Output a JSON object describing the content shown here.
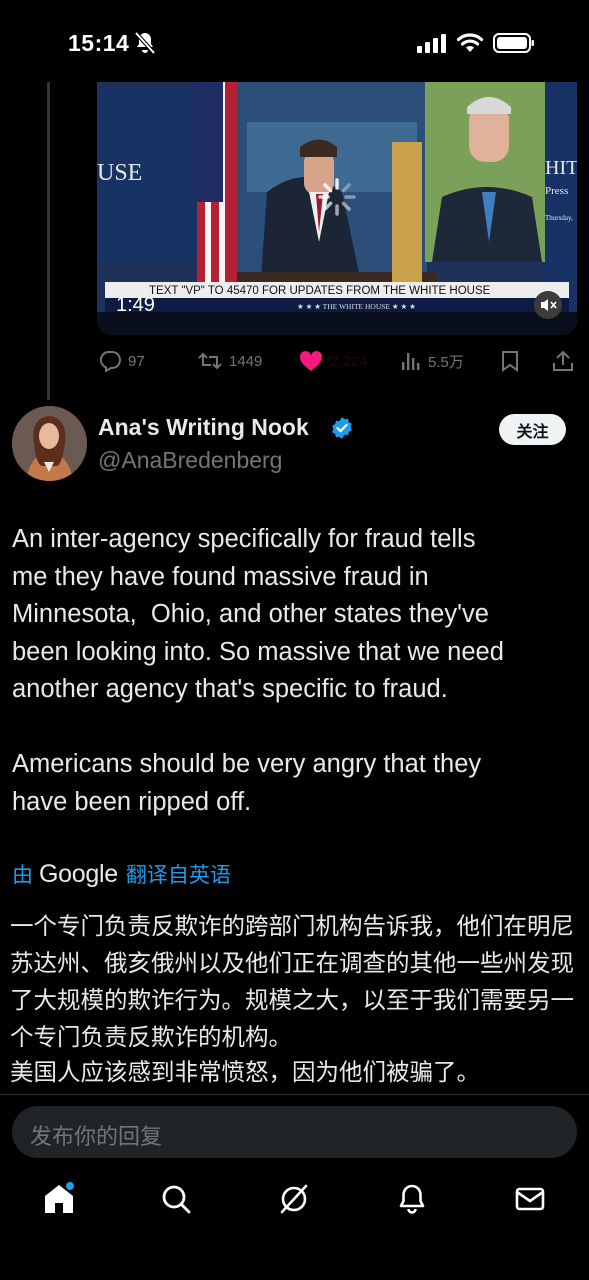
{
  "status_bar": {
    "time": "15:14",
    "icons": [
      "bell-muted-icon",
      "signal-icon",
      "wifi-icon",
      "battery-icon"
    ]
  },
  "video": {
    "duration": "1:49",
    "chyron": "TEXT \"VP\" TO 45470 FOR UPDATES FROM THE WHITE HOUSE",
    "chyron_sub": "★ ★ ★  THE WHITE HOUSE  ★ ★ ★",
    "backdrop_left_text": "USE",
    "backdrop_right_text": "HIT",
    "backdrop_right_sub": "Press",
    "backdrop_right_date": "Thursday,"
  },
  "actions": {
    "replies": "97",
    "reposts": "1449",
    "likes": "2,224",
    "views": "5.5万"
  },
  "author": {
    "name": "Ana's Writing Nook",
    "handle": "@AnaBredenberg",
    "follow_label": "关注",
    "verified": true
  },
  "tweet": {
    "text": "An inter-agency specifically for fraud tells\nme they have found massive fraud in\nMinnesota,  Ohio, and other states they've\nbeen looking into. So massive that we need\nanother agency that's specific to fraud.\n\nAmericans should be very angry that they\nhave been ripped off."
  },
  "translation": {
    "by_label": "由",
    "provider": "Google",
    "translated_from": "翻译自英语",
    "text_p1": "一个专门负责反欺诈的跨部门机构告诉我，他们在明尼苏达州、俄亥俄州以及他们正在调查的其他一些州发现了大规模的欺诈行为。规模之大，以至于我们需要另一个专门负责反欺诈的机构。",
    "text_p2": "美国人应该感到非常愤怒，因为他们被骗了。"
  },
  "reply": {
    "placeholder": "发布你的回复"
  },
  "nav": {
    "items": [
      "home-icon",
      "search-icon",
      "grok-icon",
      "notifications-icon",
      "messages-icon"
    ]
  },
  "colors": {
    "accent": "#1d9bf0",
    "like": "#f91880",
    "muted": "#71767b",
    "background": "#000000"
  }
}
